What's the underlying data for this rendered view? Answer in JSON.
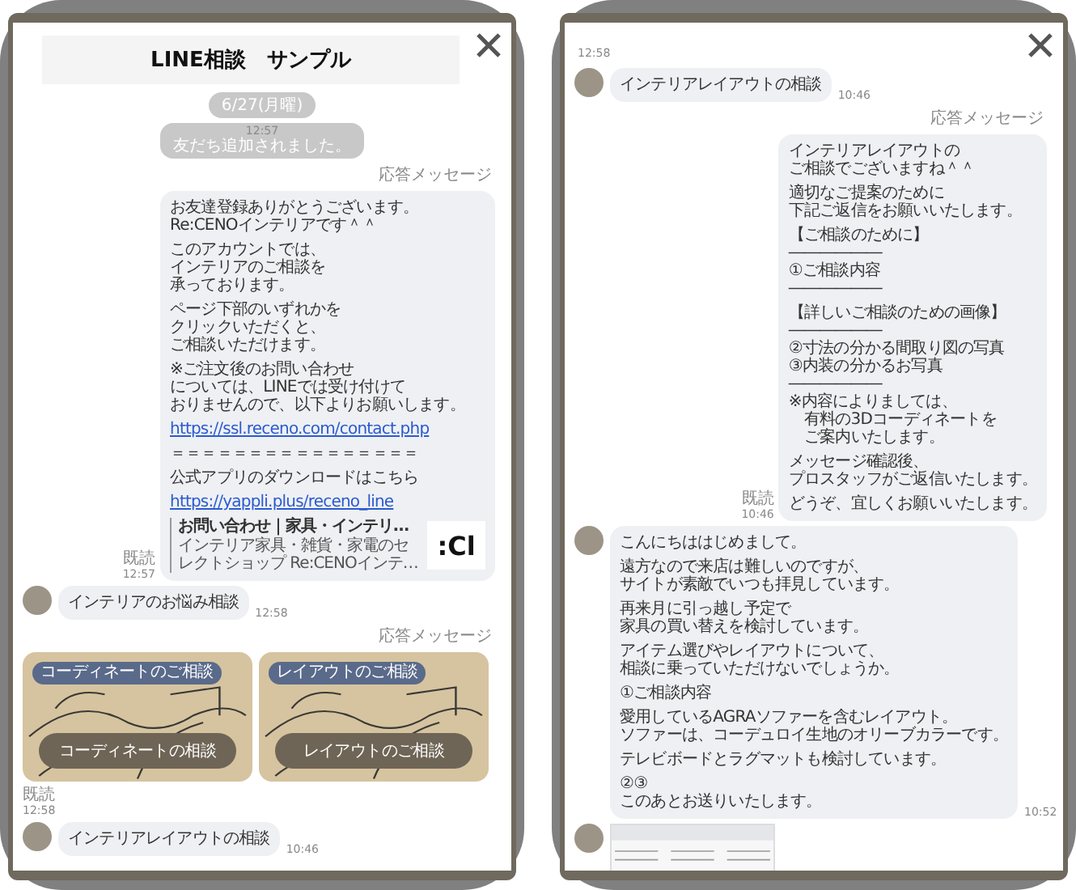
{
  "phones": [
    {
      "messages": [
        {
          "kind": "header",
          "text": "LINE相談　サンプル"
        },
        {
          "kind": "date",
          "text": "6/27(月曜)"
        },
        {
          "kind": "system",
          "time": "12:57",
          "text": "友だち追加されました。"
        },
        {
          "kind": "label",
          "text": "応答メッセージ"
        },
        {
          "kind": "bot",
          "read": "既読",
          "time": "12:57",
          "paragraphs": [
            {
              "kind": "text",
              "lines": [
                "お友達登録ありがとうございます。",
                "Re:CENOインテリアです＾＾"
              ]
            },
            {
              "kind": "text",
              "lines": [
                "このアカウントでは、",
                "インテリアのご相談を",
                "承っております。"
              ]
            },
            {
              "kind": "text",
              "lines": [
                "ページ下部のいずれかを",
                "クリックいただくと、",
                "ご相談いただけます。"
              ]
            },
            {
              "kind": "text",
              "lines": [
                "※ご注文後のお問い合わせ",
                "については、LINEでは受け付けて",
                "おりませんので、以下よりお願いします。"
              ]
            },
            {
              "kind": "link",
              "lines": [
                "https://ssl.receno.com/contact.php"
              ]
            },
            {
              "kind": "text",
              "lines": [
                "＝＝＝＝＝＝＝＝＝＝＝＝＝＝＝＝"
              ]
            },
            {
              "kind": "text",
              "lines": [
                "公式アプリのダウンロードはこちら"
              ]
            },
            {
              "kind": "link",
              "lines": [
                "https://yappli.plus/receno_line"
              ]
            }
          ],
          "link_card": {
            "title": "お問い合わせ｜家具・インテリ…",
            "description": "インテリア家具・雑貨・家電のセレクトショップ Re:CENOインテ…",
            "thumbnail": ":Cl"
          }
        },
        {
          "kind": "user",
          "time": "12:58",
          "paragraphs": [
            [
              "インテリアのお悩み相談"
            ]
          ]
        },
        {
          "kind": "label",
          "text": "応答メッセージ"
        },
        {
          "kind": "carousel",
          "cards": [
            {
              "tag": "コーディネートのご相談",
              "button": "コーディネートの相談"
            },
            {
              "tag": "レイアウトのご相談",
              "button": "レイアウトのご相談"
            }
          ]
        },
        {
          "kind": "receipt",
          "read": "既読",
          "time": "12:58"
        },
        {
          "kind": "user",
          "time": "10:46",
          "paragraphs": [
            [
              "インテリアレイアウトの相談"
            ]
          ]
        }
      ]
    },
    {
      "messages": [
        {
          "kind": "stamp",
          "text": "12:58"
        },
        {
          "kind": "user",
          "time": "10:46",
          "paragraphs": [
            [
              "インテリアレイアウトの相談"
            ]
          ]
        },
        {
          "kind": "label",
          "text": "応答メッセージ"
        },
        {
          "kind": "bot",
          "read": "既読",
          "time": "10:46",
          "paragraphs": [
            {
              "kind": "text",
              "lines": [
                "インテリアレイアウトの",
                "ご相談でございますね＾＾"
              ]
            },
            {
              "kind": "text",
              "lines": [
                "適切なご提案のために",
                "下記ご返信をお願いいたします。"
              ]
            },
            {
              "kind": "text",
              "lines": [
                "【ご相談のために】",
                "――――――",
                "①ご相談内容",
                "――――――"
              ]
            },
            {
              "kind": "text",
              "lines": [
                "【詳しいご相談のための画像】",
                "――――――",
                "②寸法の分かる間取り図の写真",
                "③内装の分かるお写真",
                "――――――",
                "※内容によりましては、",
                "　有料の3Dコーディネートを",
                "　ご案内いたします。"
              ]
            },
            {
              "kind": "text",
              "lines": [
                "メッセージ確認後、",
                "プロスタッフがご返信いたします。"
              ]
            },
            {
              "kind": "text",
              "lines": [
                "どうぞ、宜しくお願いいたします。"
              ]
            }
          ]
        },
        {
          "kind": "user",
          "time": "10:52",
          "paragraphs": [
            [
              "こんにちははじめまして。"
            ],
            [
              "遠方なので来店は難しいのですが、",
              "サイトが素敵でいつも拝見しています。"
            ],
            [
              "再来月に引っ越し予定で",
              "家具の買い替えを検討しています。"
            ],
            [
              "アイテム選びやレイアウトについて、",
              "相談に乗っていただけないでしょうか。"
            ],
            [
              "①ご相談内容"
            ],
            [
              "愛用しているAGRAソファーを含むレイアウト。",
              "ソファーは、コーデュロイ生地のオリーブカラーです。"
            ],
            [
              "テレビボードとラグマットも検討しています。"
            ],
            [
              "②③",
              "このあとお送りいたします。"
            ]
          ]
        },
        {
          "kind": "user_image"
        }
      ]
    }
  ]
}
